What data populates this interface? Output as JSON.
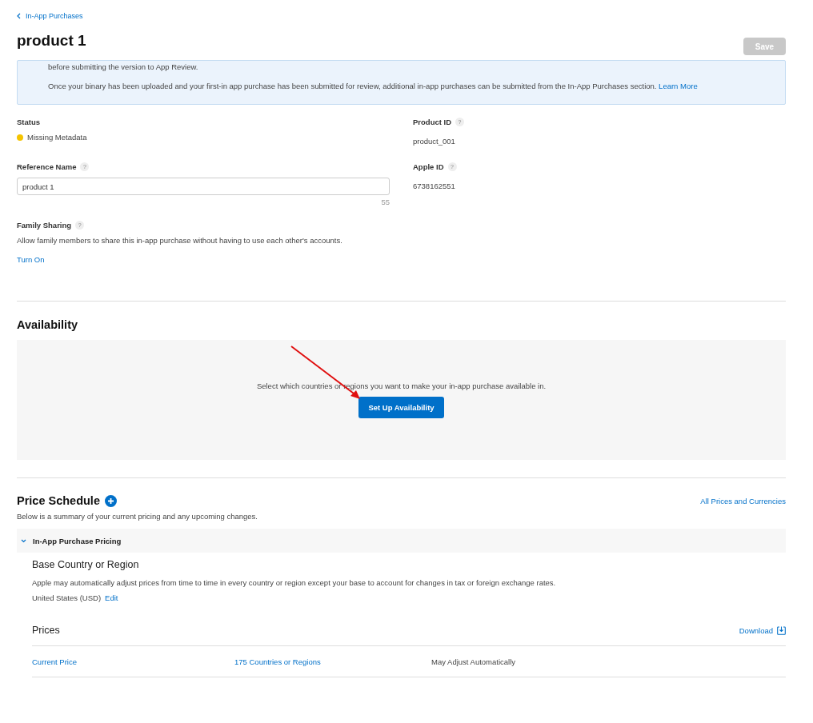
{
  "breadcrumb": "In-App Purchases",
  "title": "product 1",
  "save_button": {
    "label": "Save",
    "disabled": true
  },
  "notice": {
    "lines": [
      "before submitting the version to App Review.",
      "Once your binary has been uploaded and your first-in app purchase has been submitted for review, additional in-app purchases can be submitted from the In-App Purchases section."
    ],
    "link": "Learn More"
  },
  "status": {
    "label": "Status",
    "value": "Missing Metadata",
    "color": "#f5c400"
  },
  "product_id": {
    "label": "Product ID",
    "help": "?",
    "value": "product_001"
  },
  "reference_name": {
    "label": "Reference Name",
    "help": "?",
    "value": "product 1",
    "counter": "55"
  },
  "apple_id": {
    "label": "Apple ID",
    "help": "?",
    "value": "6738162551"
  },
  "family_sharing": {
    "label": "Family Sharing",
    "help": "?",
    "description": "Allow family members to share this in-app purchase without having to use each other's accounts.",
    "link": "Turn On"
  },
  "availability": {
    "title": "Availability",
    "text": "Select which countries or regions you want to make your in-app purchase available in.",
    "button": "Set Up Availability"
  },
  "price_schedule": {
    "title": "Price Schedule",
    "link": "All Prices and Currencies",
    "description": "Below is a summary of your current pricing and any upcoming changes.",
    "section": {
      "label": "In-App Purchase Pricing",
      "expanded": true
    },
    "base": {
      "title": "Base Country or Region",
      "description": "Apple may automatically adjust prices from time to time in every country or region except your base to account for changes in tax or foreign exchange rates.",
      "value": "United States (USD)",
      "edit": "Edit"
    },
    "prices": {
      "title": "Prices",
      "download": "Download",
      "row": [
        "Current Price",
        "175 Countries or Regions",
        "May Adjust Automatically"
      ]
    }
  }
}
